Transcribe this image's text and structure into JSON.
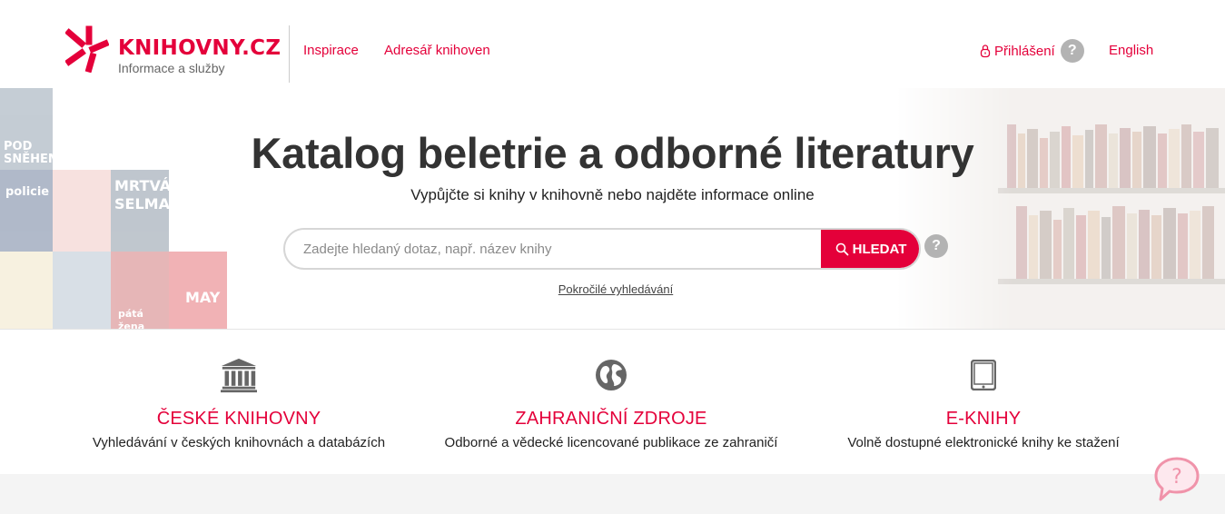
{
  "header": {
    "logo": {
      "name": "KNIHOVNY.CZ",
      "subtitle": "Informace a služby",
      "brand_color": "#e4003a"
    },
    "nav": [
      {
        "label": "Inspirace"
      },
      {
        "label": "Adresář knihoven"
      }
    ],
    "login_label": "Přihlášení",
    "help_symbol": "?",
    "language_label": "English"
  },
  "hero": {
    "title": "Katalog beletrie a odborné literatury",
    "subtitle": "Vypůjčte si knihy v knihovně nebo najděte informace online",
    "search": {
      "placeholder": "Zadejte hledaný dotaz, např. název knihy",
      "value": "",
      "button_label": "HLEDAT",
      "help_symbol": "?"
    },
    "advanced_search_label": "Pokročilé vyhledávání",
    "book_covers": [
      {
        "title": "POD SNĚHEM"
      },
      {
        "title": "policie"
      },
      {
        "title": "MRTVÁ SELMA"
      },
      {
        "title": "MAY"
      },
      {
        "title": "pátá žena"
      }
    ]
  },
  "services": [
    {
      "icon": "library-building-icon",
      "title": "ČESKÉ KNIHOVNY",
      "description": "Vyhledávání v českých knihovnách a databázích"
    },
    {
      "icon": "globe-icon",
      "title": "ZAHRANIČNÍ ZDROJE",
      "description": "Odborné a vědecké licencované publikace ze zahraničí"
    },
    {
      "icon": "tablet-icon",
      "title": "E-KNIHY",
      "description": "Volně dostupné elektronické knihy ke stažení"
    }
  ],
  "chat_widget": {
    "icon": "chat-help-icon",
    "symbol": "?"
  },
  "colors": {
    "accent": "#e4003a",
    "icon_gray": "#666666",
    "help_gray": "#b3b3b3",
    "footer_bg": "#f4f4f4"
  }
}
